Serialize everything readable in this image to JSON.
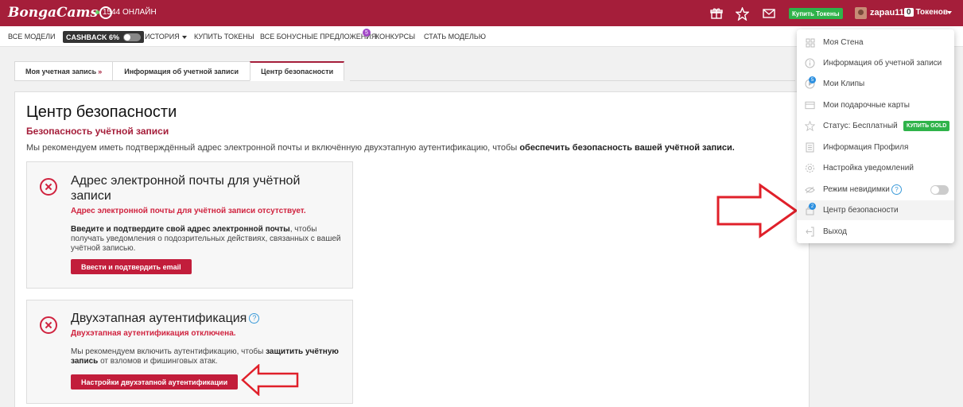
{
  "header": {
    "logo_text": "BongaCams",
    "online_text": "1544 ОНЛАЙН",
    "buy_tokens_label": "Купить Токены",
    "username": "zapau11",
    "tokens_count": "0",
    "tokens_label": "Токенов"
  },
  "subnav": {
    "all_models": "ВСЕ МОДЕЛИ",
    "cashback": "CASHBACK 6%",
    "history": "ИСТОРИЯ",
    "buy_tokens": "КУПИТЬ ТОКЕНЫ",
    "bonus_offers": "ВСЕ БОНУСНЫЕ ПРЕДЛОЖЕНИЯ",
    "bonus_badge": "5",
    "contests": "КОНКУРСЫ",
    "become_model": "СТАТЬ МОДЕЛЬЮ"
  },
  "tabs": {
    "my_account": "Моя учетная запись",
    "my_account_chevron": "»",
    "account_info": "Информация об учетной записи",
    "security_center": "Центр безопасности"
  },
  "main": {
    "title": "Центр безопасности",
    "subtitle": "Безопасность учётной записи",
    "intro_plain": "Мы рекомендуем иметь подтверждённый адрес электронной почты и включённую двухэтапную аутентификацию, чтобы ",
    "intro_bold": "обеспечить безопасность вашей учётной записи."
  },
  "card_email": {
    "title": "Адрес электронной почты для учётной записи",
    "status": "Адрес электронной почты для учётной записи отсутствует.",
    "text_bold": "Введите и подтвердите свой адрес электронной почты",
    "text_plain": ", чтобы получать уведомления о подозрительных действиях, связанных с вашей учётной записью.",
    "button": "Ввести и подтвердить email"
  },
  "card_2fa": {
    "title": "Двухэтапная аутентификация",
    "help": "?",
    "status": "Двухэтапная аутентификация отключена.",
    "text_plain": "Мы рекомендуем включить аутентификацию, чтобы ",
    "text_bold": "защитить учётную запись",
    "text_plain2": " от взломов и фишинговых атак.",
    "button": "Настройки двухэтапной аутентификации"
  },
  "dropdown": {
    "items": [
      {
        "label": "Моя Стена",
        "icon": "wall-icon"
      },
      {
        "label": "Информация об учетной записи",
        "icon": "info-icon"
      },
      {
        "label": "Мои Клипы",
        "icon": "clips-icon",
        "badge": "5"
      },
      {
        "label": "Мои подарочные карты",
        "icon": "gift-card-icon"
      },
      {
        "label": "Статус:  Бесплатный",
        "icon": "star-icon"
      },
      {
        "label": "Информация Профиля",
        "icon": "profile-icon"
      },
      {
        "label": "Настройка уведомлений",
        "icon": "gear-icon"
      },
      {
        "label": "Режим невидимки",
        "icon": "invisible-icon"
      },
      {
        "label": "Центр безопасности",
        "icon": "lock-icon",
        "badge": "2"
      },
      {
        "label": "Выход",
        "icon": "logout-icon"
      }
    ],
    "buy_gold": "КУПИТЬ GOLD",
    "invisible_help": "?"
  },
  "colors": {
    "brand": "#a51e3a",
    "button_red": "#c21d3b",
    "error_red": "#d0233f",
    "green": "#2fb34a",
    "annotation_arrow": "#e0202a"
  }
}
